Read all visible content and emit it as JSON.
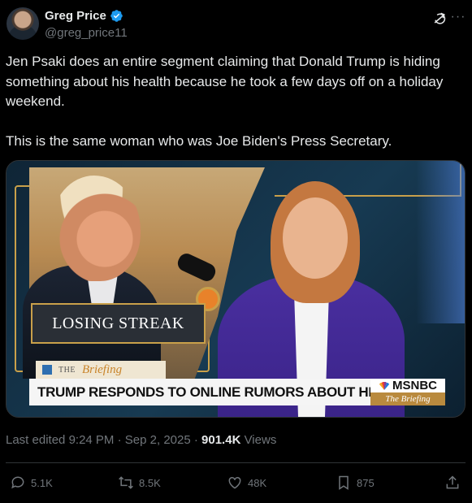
{
  "author": {
    "name": "Greg Price",
    "handle": "@greg_price11",
    "verified": true
  },
  "tweet": {
    "text": "Jen Psaki does an entire segment claiming that Donald Trump is hiding something about his health because he took a few days off on a holiday weekend.\n\nThis is the same woman who was Joe Biden's Press Secretary."
  },
  "media": {
    "lower_third_left": "LOSING STREAK",
    "show_tag_the": "THE",
    "show_tag_name": "Briefing",
    "chyron": "TRUMP RESPONDS TO ONLINE RUMORS ABOUT HIS HEALTH",
    "network": "MSNBC",
    "network_show": "The Briefing"
  },
  "meta": {
    "edited_label": "Last edited",
    "time": "9:24 PM",
    "date": "Sep 2, 2025",
    "views_count": "901.4K",
    "views_label": "Views"
  },
  "actions": {
    "replies": "5.1K",
    "reposts": "8.5K",
    "likes": "48K",
    "bookmarks": "875"
  },
  "colors": {
    "background": "#000000",
    "text": "#e7e9ea",
    "muted": "#71767b",
    "verified": "#1d9bf0"
  }
}
